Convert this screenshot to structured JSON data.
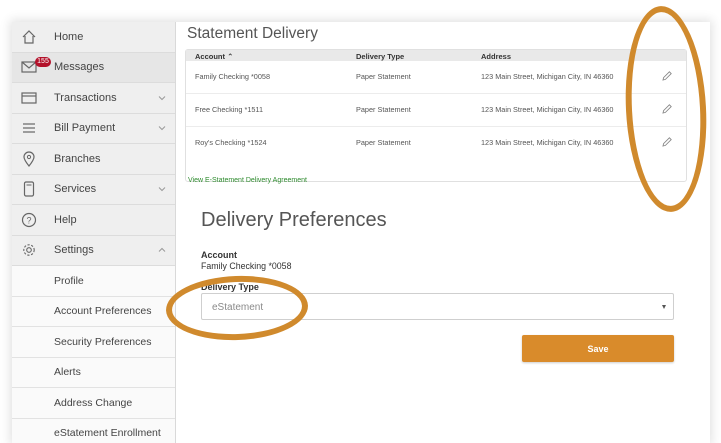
{
  "sidebar": {
    "items": [
      {
        "label": "Home",
        "icon": "home-icon"
      },
      {
        "label": "Messages",
        "icon": "envelope-icon",
        "badge": "155"
      },
      {
        "label": "Transactions",
        "icon": "card-icon",
        "expandable": true
      },
      {
        "label": "Bill Payment",
        "icon": "list-icon",
        "expandable": true
      },
      {
        "label": "Branches",
        "icon": "location-pin-icon"
      },
      {
        "label": "Services",
        "icon": "phone-icon",
        "expandable": true
      },
      {
        "label": "Help",
        "icon": "help-icon"
      },
      {
        "label": "Settings",
        "icon": "gear-icon",
        "expanded": true
      }
    ],
    "sub_items": [
      "Profile",
      "Account Preferences",
      "Security Preferences",
      "Alerts",
      "Address Change",
      "eStatement Enrollment"
    ]
  },
  "main": {
    "title": "Statement Delivery",
    "table": {
      "headers": [
        "Account ⌃",
        "Delivery Type",
        "Address"
      ],
      "rows": [
        {
          "account": "Family Checking *0058",
          "delivery": "Paper Statement",
          "address": "123 Main Street, Michigan City, IN 46360"
        },
        {
          "account": "Free Checking *1511",
          "delivery": "Paper Statement",
          "address": "123 Main Street, Michigan City, IN 46360"
        },
        {
          "account": "Roy's Checking *1524",
          "delivery": "Paper Statement",
          "address": "123 Main Street, Michigan City, IN 46360"
        }
      ]
    },
    "agreement_link": "View E-Statement Delivery Agreement",
    "preferences": {
      "title": "Delivery Preferences",
      "account_label": "Account",
      "account_value": "Family Checking *0058",
      "delivery_label": "Delivery Type",
      "delivery_value": "eStatement",
      "save_label": "Save"
    }
  },
  "colors": {
    "accent": "#d98b2b",
    "highlight": "#d08a2d",
    "link": "#2e8b2e",
    "badge": "#b3112a",
    "sidebar_bg": "#efefef"
  }
}
